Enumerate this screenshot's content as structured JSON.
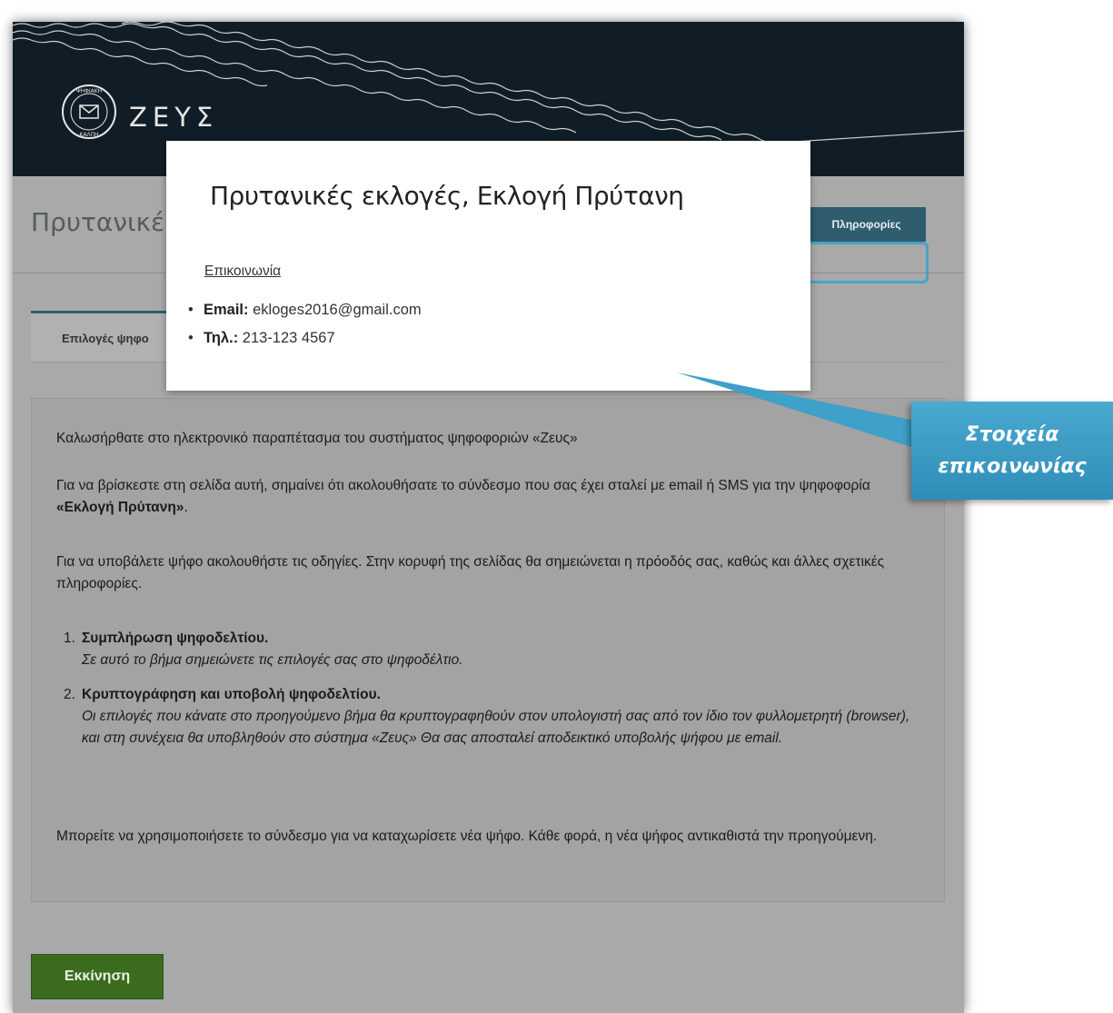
{
  "header": {
    "logo_text": "ΖΕΥΣ",
    "seal_text_top": "ΨΗΦΙΑΚΗ",
    "seal_text_bottom": "ΚΑΛΠΗ"
  },
  "page": {
    "title_partial": "Πρυτανικέ",
    "info_button_label": "Πληροφορίες",
    "tab_label": "Επιλογές ψηφο"
  },
  "modal": {
    "title": "Πρυτανικές εκλογές, Εκλογή Πρύτανη",
    "contact_link": "Επικοινωνία",
    "contacts": [
      {
        "label": "Email:",
        "value": " ekloges2016@gmail.com"
      },
      {
        "label": "Τηλ.:",
        "value": " 213-123 4567"
      }
    ]
  },
  "content": {
    "welcome": "Καλωσήρθατε στο ηλεκτρονικό παραπέτασμα του συστήματος ψηφοφοριών «Ζευς»",
    "link_info_pre": "Για να βρίσκεστε στη σελίδα αυτή, σημαίνει ότι ακολουθήσατε το σύνδεσμο που σας έχει σταλεί με email ή SMS για την ψηφοφορία ",
    "link_info_bold": "«Εκλογή Πρύτανη»",
    "link_info_post": ".",
    "instructions": "Για να υποβάλετε ψήφο ακολουθήστε τις οδηγίες. Στην κορυφή της σελίδας θα σημειώνεται η πρόοδός σας, καθώς και άλλες σχετικές πληροφορίες.",
    "steps": [
      {
        "num": "1.",
        "title": "Συμπλήρωση ψηφοδελτίου.",
        "desc": "Σε αυτό το βήμα σημειώνετε τις επιλογές σας στο ψηφοδέλτιο."
      },
      {
        "num": "2.",
        "title": "Κρυπτογράφηση και υποβολή ψηφοδελτίου.",
        "desc": "Οι επιλογές που κάνατε στο προηγούμενο βήμα θα κρυπτογραφηθούν στον υπολογιστή σας από τον ίδιο τον φυλλομετρητή (browser), και στη συνέχεια θα υποβληθούν στο σύστημα «Ζευς» Θα σας αποσταλεί αποδεικτικό υποβολής ψήφου με email."
      }
    ],
    "revote": "Μπορείτε να χρησιμοποιήσετε το σύνδεσμο για να καταχωρίσετε νέα ψήφο. Κάθε φορά, η νέα ψήφος αντικαθιστά την προηγούμενη."
  },
  "start_button_label": "Εκκίνηση",
  "callout": {
    "line1": "Στοιχεία",
    "line2": "επικοινωνίας"
  },
  "colors": {
    "header_bg": "#111d26",
    "accent": "#2f5d6e",
    "start_button": "#3b6b1f",
    "callout": "#3a9cc6"
  }
}
